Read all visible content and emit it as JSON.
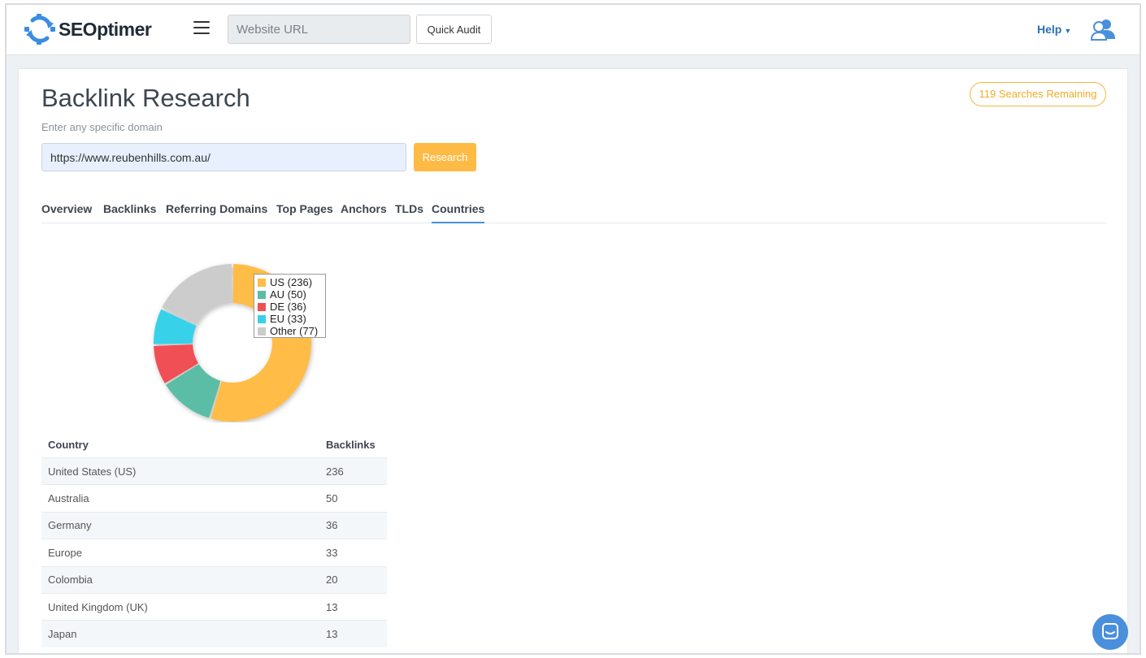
{
  "navbar": {
    "brand": "SEOptimer",
    "url_placeholder": "Website URL",
    "quick_audit_label": "Quick Audit",
    "help_label": "Help"
  },
  "page": {
    "title": "Backlink Research",
    "searches_remaining": "119 Searches Remaining",
    "hint": "Enter any specific domain",
    "domain_value": "https://www.reubenhills.com.au/",
    "research_label": "Research"
  },
  "tabs": [
    {
      "label": "Overview"
    },
    {
      "label": "Backlinks"
    },
    {
      "label": "Referring Domains"
    },
    {
      "label": "Top Pages"
    },
    {
      "label": "Anchors"
    },
    {
      "label": "TLDs"
    },
    {
      "label": "Countries",
      "active": true
    }
  ],
  "chart_data": {
    "type": "pie",
    "donut": true,
    "categories": [
      "US",
      "AU",
      "DE",
      "EU",
      "Other"
    ],
    "values": [
      236,
      50,
      36,
      33,
      77
    ],
    "legend_labels": [
      "US (236)",
      "AU (50)",
      "DE (36)",
      "EU (33)",
      "Other (77)"
    ],
    "colors": [
      "#FFBC47",
      "#5BBDA6",
      "#EF5054",
      "#38D1EA",
      "#CCCCCC"
    ],
    "legend_placement": "right",
    "title": ""
  },
  "table": {
    "headers": [
      "Country",
      "Backlinks"
    ],
    "rows": [
      [
        "United States (US)",
        "236"
      ],
      [
        "Australia",
        "50"
      ],
      [
        "Germany",
        "36"
      ],
      [
        "Europe",
        "33"
      ],
      [
        "Colombia",
        "20"
      ],
      [
        "United Kingdom (UK)",
        "13"
      ],
      [
        "Japan",
        "13"
      ]
    ]
  },
  "colors": {
    "accent": "#FDBB45",
    "link": "#2E6FB7",
    "tab_active": "#4A90D9",
    "chat": "#4A8FDC"
  },
  "icons": {
    "logo": "seoptimer-gear-icon",
    "menu": "hamburger-menu-icon",
    "user": "user-account-icon",
    "chat": "chat-bubble-icon"
  }
}
